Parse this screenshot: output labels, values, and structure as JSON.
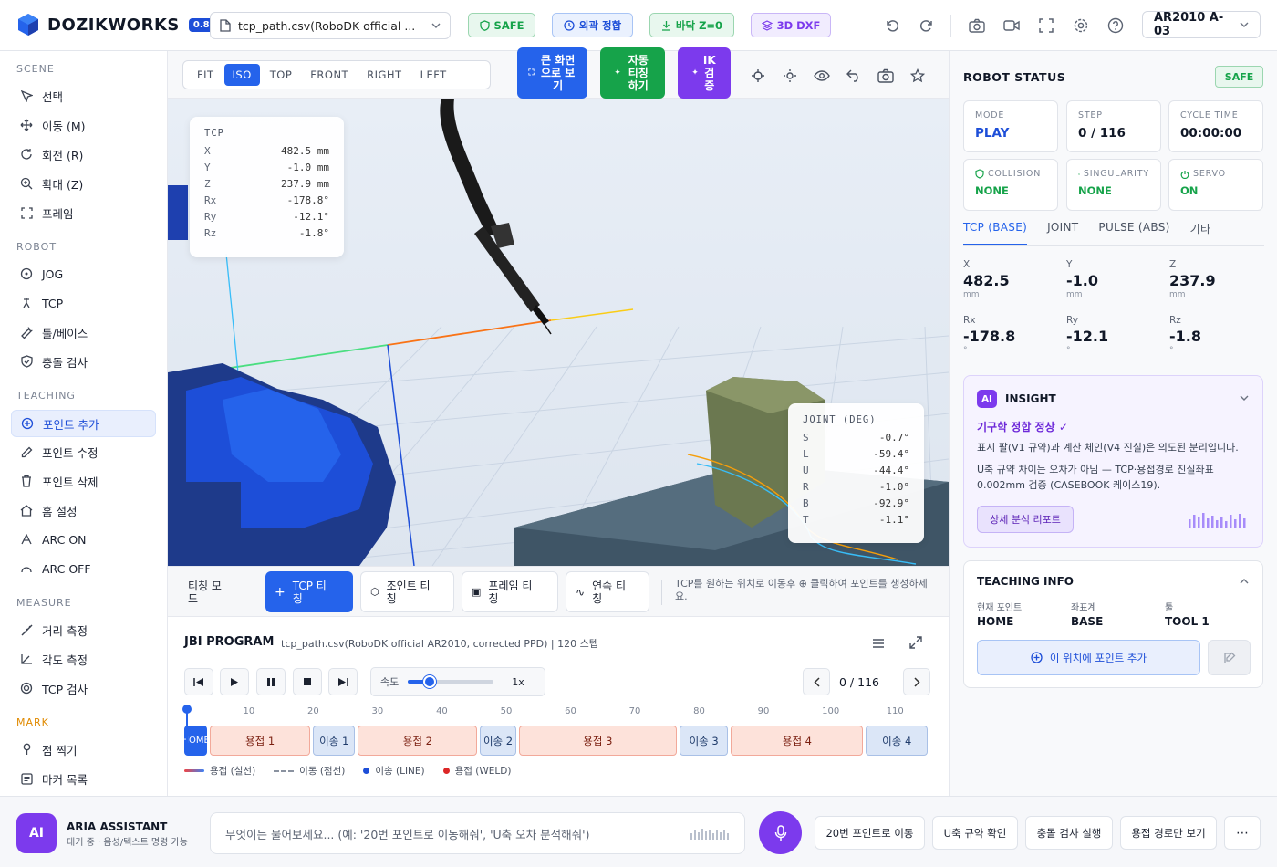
{
  "app": {
    "name": "DOZIKWORKS",
    "version": "0.8"
  },
  "topbar": {
    "file": "tcp_path.csv(RoboDK official ...",
    "chips": {
      "safe": "SAFE",
      "outer": "외곽 정합",
      "floor": "바닥 Z=0",
      "dxf": "3D DXF"
    },
    "robot": "AR2010 A-03"
  },
  "sidebar": {
    "scene_title": "SCENE",
    "scene": [
      "선택",
      "이동 (M)",
      "회전 (R)",
      "확대 (Z)",
      "프레임"
    ],
    "robot_title": "ROBOT",
    "robot": [
      "JOG",
      "TCP",
      "툴/베이스",
      "충돌 검사"
    ],
    "teaching_title": "TEACHING",
    "teaching": [
      "포인트 추가",
      "포인트 수정",
      "포인트 삭제",
      "홈 설정",
      "ARC ON",
      "ARC OFF"
    ],
    "measure_title": "MEASURE",
    "measure": [
      "거리 측정",
      "각도 측정",
      "TCP 검사"
    ],
    "mark_title": "MARK",
    "mark": [
      "점 찍기",
      "마커 목록"
    ]
  },
  "viewbar": {
    "views": [
      "FIT",
      "ISO",
      "TOP",
      "FRONT",
      "RIGHT",
      "LEFT"
    ],
    "big_view": "큰 화면으로 보기",
    "auto_teach": "자동 티칭 하기",
    "ik_check": "IK 검증"
  },
  "tcp_overlay": {
    "title": "TCP",
    "rows": [
      [
        "X",
        "482.5 mm"
      ],
      [
        "Y",
        "-1.0 mm"
      ],
      [
        "Z",
        "237.9 mm"
      ],
      [
        "Rx",
        "-178.8°"
      ],
      [
        "Ry",
        "-12.1°"
      ],
      [
        "Rz",
        "-1.8°"
      ]
    ]
  },
  "joint_overlay": {
    "title": "JOINT (DEG)",
    "rows": [
      [
        "S",
        "-0.7°"
      ],
      [
        "L",
        "-59.4°"
      ],
      [
        "U",
        "-44.4°"
      ],
      [
        "R",
        "-1.0°"
      ],
      [
        "B",
        "-92.9°"
      ],
      [
        "T",
        "-1.1°"
      ]
    ]
  },
  "teachbar": {
    "mode": "티칭 모드",
    "tcp": "TCP 티칭",
    "joint": "조인트 티칭",
    "frame": "프레임 티칭",
    "continuous": "연속 티칭",
    "hint": "TCP를 원하는 위치로 이동후 ⊕ 클릭하여 포인트를 생성하세요."
  },
  "jbi": {
    "title": "JBI PROGRAM",
    "subtitle": "tcp_path.csv(RoboDK official AR2010, corrected PPD) | 120 스텝",
    "speed_label": "속도",
    "speed_value": "1x",
    "speed_fraction": 0.25,
    "step": "0 / 116",
    "ticks": [
      "10",
      "20",
      "30",
      "40",
      "50",
      "60",
      "70",
      "80",
      "90",
      "100",
      "110"
    ],
    "segments": [
      {
        "label": "HOME",
        "kind": "home",
        "start": 0,
        "end": 4
      },
      {
        "label": "용접 1",
        "kind": "weld",
        "start": 4,
        "end": 20
      },
      {
        "label": "이송 1",
        "kind": "move",
        "start": 20,
        "end": 27
      },
      {
        "label": "용접 2",
        "kind": "weld",
        "start": 27,
        "end": 46
      },
      {
        "label": "이송 2",
        "kind": "move",
        "start": 46,
        "end": 52
      },
      {
        "label": "용접 3",
        "kind": "weld",
        "start": 52,
        "end": 77
      },
      {
        "label": "이송 3",
        "kind": "move",
        "start": 77,
        "end": 85
      },
      {
        "label": "용접 4",
        "kind": "weld",
        "start": 85,
        "end": 106
      },
      {
        "label": "이송 4",
        "kind": "move",
        "start": 106,
        "end": 116
      }
    ],
    "legend": [
      "용접 (실선)",
      "이동 (점선)",
      "이송 (LINE)",
      "용접 (WELD)"
    ]
  },
  "status": {
    "title": "ROBOT STATUS",
    "safe": "SAFE",
    "cards": [
      {
        "label": "MODE",
        "value": "PLAY",
        "color": "#1d4ed8"
      },
      {
        "label": "STEP",
        "value": "0 / 116",
        "color": "#111827"
      },
      {
        "label": "CYCLE TIME",
        "value": "00:00:00",
        "color": "#111827"
      },
      {
        "label": "COLLISION",
        "value": "NONE",
        "color": "#16a34a"
      },
      {
        "label": "SINGULARITY",
        "value": "NONE",
        "color": "#16a34a"
      },
      {
        "label": "SERVO",
        "value": "ON",
        "color": "#16a34a"
      }
    ],
    "tabs": [
      "TCP (BASE)",
      "JOINT",
      "PULSE (ABS)",
      "기타"
    ],
    "coords": [
      {
        "label": "X",
        "value": "482.5",
        "unit": "mm"
      },
      {
        "label": "Y",
        "value": "-1.0",
        "unit": "mm"
      },
      {
        "label": "Z",
        "value": "237.9",
        "unit": "mm"
      },
      {
        "label": "Rx",
        "value": "-178.8",
        "unit": "°"
      },
      {
        "label": "Ry",
        "value": "-12.1",
        "unit": "°"
      },
      {
        "label": "Rz",
        "value": "-1.8",
        "unit": "°"
      }
    ]
  },
  "insight": {
    "badge": "AI",
    "title": "INSIGHT",
    "headline": "기구학 정합 정상 ✓",
    "p1": "표시 팔(V1 규약)과 계산 체인(V4 진실)은 의도된 분리입니다.",
    "p2": "U축 규약 차이는 오차가 아님 — TCP·용접경로 진실좌표 0.002mm 검증 (CASEBOOK 케이스19).",
    "button": "상세 분석 리포트"
  },
  "teaching_info": {
    "title": "TEACHING INFO",
    "labels": [
      "현재 포인트",
      "좌표계",
      "툴"
    ],
    "values": [
      "HOME",
      "BASE",
      "TOOL 1"
    ],
    "add_button": "이 위치에 포인트 추가"
  },
  "assistant": {
    "badge": "AI",
    "title": "ARIA ASSISTANT",
    "subtitle": "대기 중 · 음성/텍스트 명령 가능",
    "placeholder": "무엇이든 물어보세요... (예: '20번 포인트로 이동해줘', 'U축 오차 분석해줘')",
    "quick": [
      "20번 포인트로 이동",
      "U축 규약 확인",
      "충돌 검사 실행",
      "용접 경로만 보기",
      "⋯"
    ]
  }
}
